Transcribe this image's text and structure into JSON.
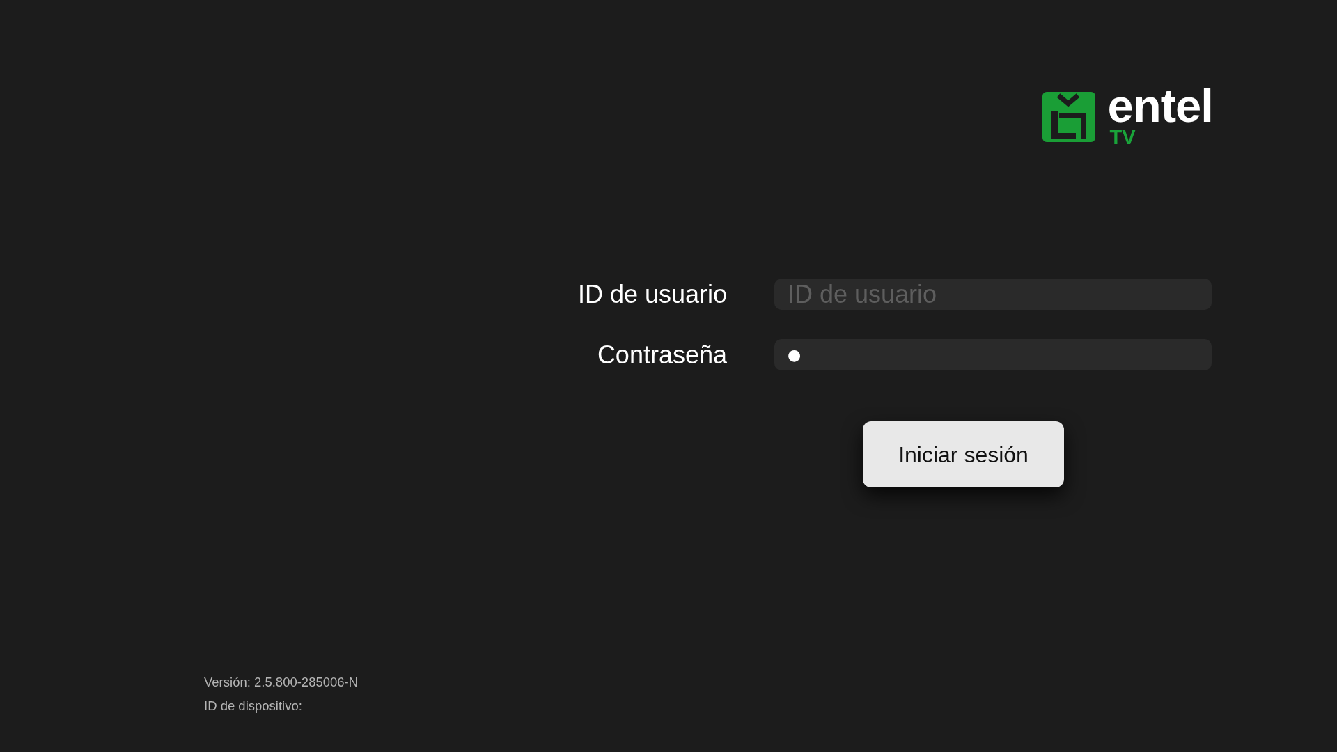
{
  "logo": {
    "wordmark": "entel",
    "subtitle": "TV"
  },
  "form": {
    "fields": [
      {
        "kind": "text",
        "label": "ID de usuario",
        "placeholder": "ID de usuario"
      },
      {
        "kind": "password",
        "label": "Contraseña",
        "value": "●"
      }
    ]
  },
  "buttons": [
    {
      "label": "Iniciar sesión"
    }
  ],
  "footer": [
    "Versión: 2.5.800-285006-N",
    "ID de dispositivo:"
  ]
}
